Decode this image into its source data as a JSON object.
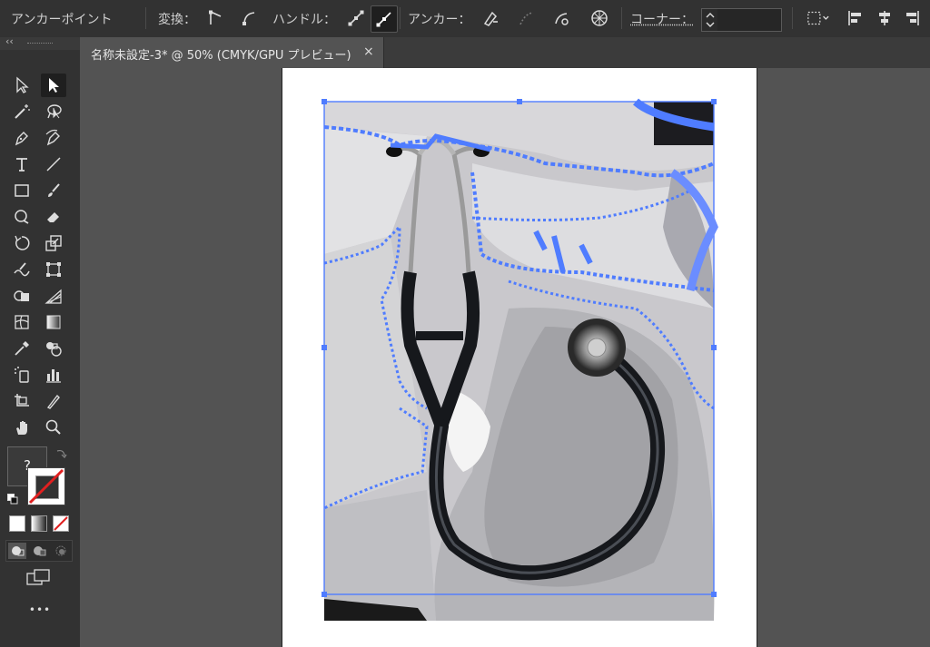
{
  "controlbar": {
    "context_label": "アンカーポイント",
    "convert_label": "変換：",
    "handles_label": "ハンドル：",
    "anchors_label": "アンカー：",
    "corner_label": "コーナー："
  },
  "document_tab": {
    "title": "名称未設定-3* @ 50% (CMYK/GPU プレビュー)",
    "close": "×"
  },
  "tools": {
    "fill_placeholder": "?",
    "more": "•••",
    "collapse": "‹‹"
  },
  "colors": {
    "background": "#535353",
    "panel": "#323232",
    "selection": "#4f7cff",
    "artboard": "#ffffff",
    "accent_red": "#e02020"
  }
}
